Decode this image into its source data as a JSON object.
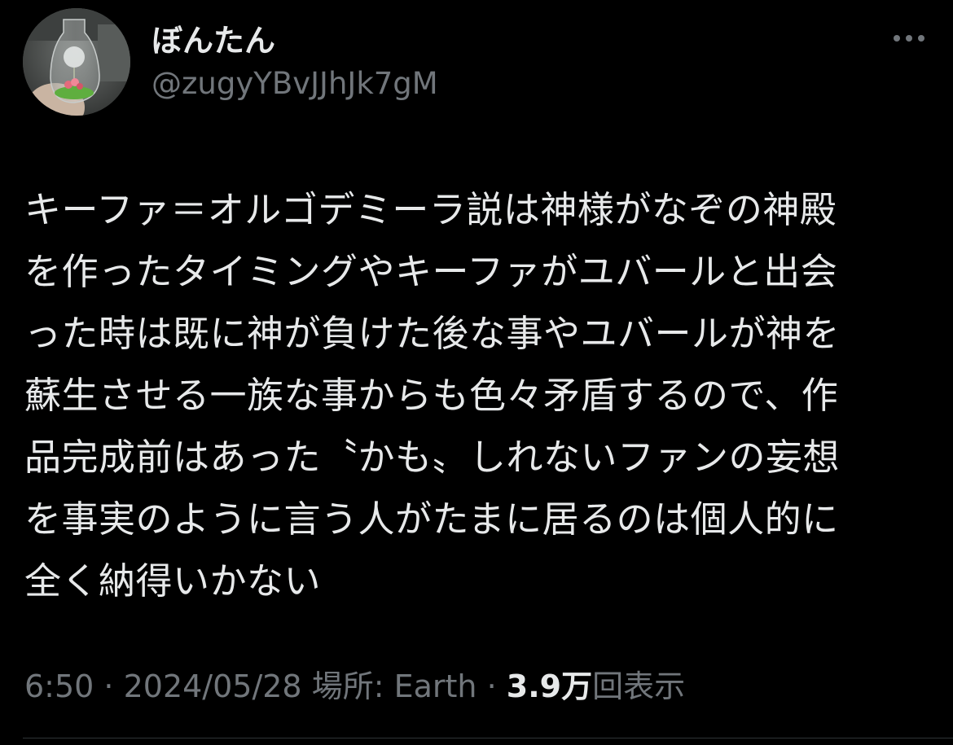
{
  "author": {
    "display_name": "ぼんたん",
    "handle": "@zugyYBvJJhJk7gM"
  },
  "tweet": {
    "lines": [
      "キーファ＝オルゴデミーラ説は神様がなぞの神殿",
      "を作ったタイミングやキーファがユバールと出会",
      "った時は既に神が負けた後な事やユバールが神を",
      "蘇生させる一族な事からも色々矛盾するので、作",
      "品完成前はあった〝かも〟しれないファンの妄想",
      "を事実のように言う人がたまに居るのは個人的に",
      "全く納得いかない"
    ]
  },
  "meta": {
    "time": "6:50",
    "separator": " · ",
    "date": "2024/05/28",
    "location_label": "場所: Earth",
    "views_count": "3.9万",
    "views_label": "回表示"
  },
  "icons": {
    "more": "more-horizontal-icon",
    "avatar": "avatar-image"
  },
  "colors": {
    "background": "#000000",
    "text_primary": "#e7e9ea",
    "text_secondary": "#71767b",
    "divider": "#2f3336"
  }
}
